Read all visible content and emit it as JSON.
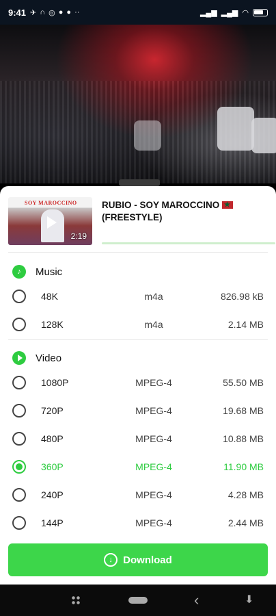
{
  "status_bar": {
    "time": "9:41",
    "icons": [
      "silent-icon",
      "headset-icon",
      "whatsapp-icon",
      "facebook-icon",
      "facebook-icon",
      "more-icon"
    ],
    "right_icons": [
      "signal-icon",
      "signal-icon",
      "wifi-icon",
      "battery-icon"
    ]
  },
  "header": {
    "duration": "2:19",
    "thumb_title": "SOY MAROCCINO",
    "title_line1": "RUBIO - SOY MAROCCINO",
    "title_line2": "(FREESTYLE)"
  },
  "music": {
    "label": "Music",
    "rows": [
      {
        "quality": "48K",
        "format": "m4a",
        "size": "826.98 kB"
      },
      {
        "quality": "128K",
        "format": "m4a",
        "size": "2.14 MB"
      }
    ]
  },
  "video": {
    "label": "Video",
    "rows": [
      {
        "quality": "1080P",
        "format": "MPEG-4",
        "size": "55.50 MB"
      },
      {
        "quality": "720P",
        "format": "MPEG-4",
        "size": "19.68 MB"
      },
      {
        "quality": "480P",
        "format": "MPEG-4",
        "size": "10.88 MB"
      },
      {
        "quality": "360P",
        "format": "MPEG-4",
        "size": "11.90 MB"
      },
      {
        "quality": "240P",
        "format": "MPEG-4",
        "size": "4.28 MB"
      },
      {
        "quality": "144P",
        "format": "MPEG-4",
        "size": "2.44 MB"
      }
    ],
    "selected_index": 3
  },
  "download_label": "Download",
  "accent_color": "#2ecc40"
}
